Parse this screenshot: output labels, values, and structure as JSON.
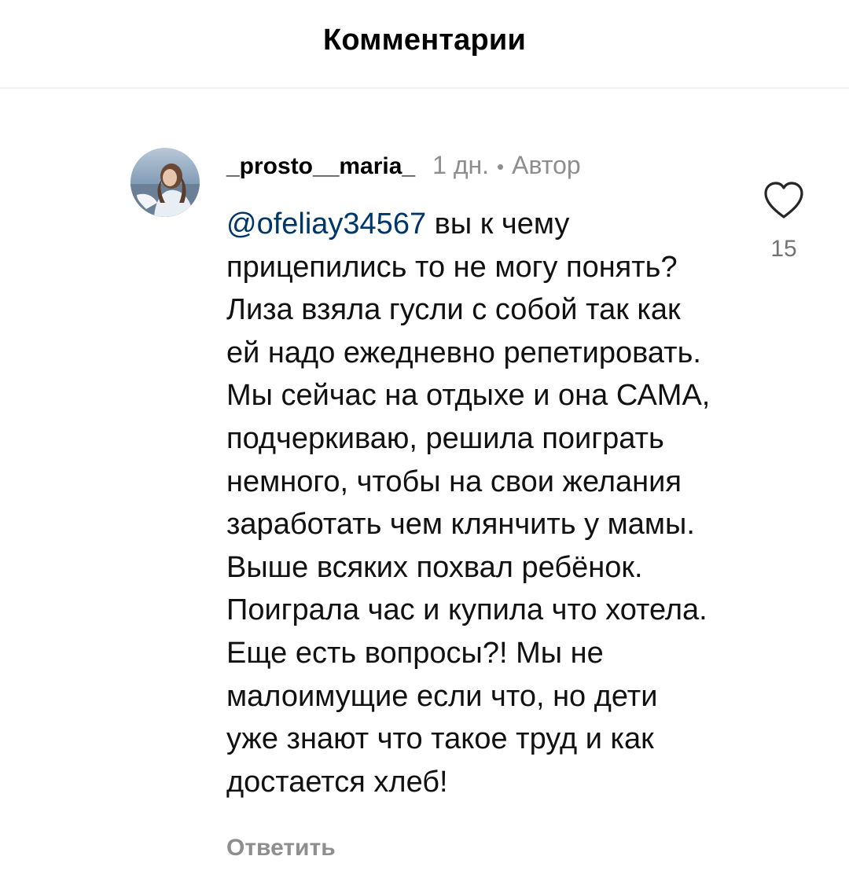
{
  "header": {
    "title": "Комментарии"
  },
  "comment": {
    "username": "_prosto__maria_",
    "time": "1 дн.",
    "separator": "•",
    "badge": "Автор",
    "mention": "@ofeliay34567",
    "text": " вы к чему прицепились то не могу понять? Лиза взяла гусли с собой так как ей надо ежедневно репетировать. Мы сейчас на отдыхе и она САМА, подчеркиваю, решила поиграть немного, чтобы на свои желания заработать чем клянчить у мамы. Выше всяких похвал ребёнок. Поиграла час и купила что хотела. Еще есть вопросы?! Мы не малоимущие если что, но дети уже знают что такое труд и как достается хлеб!",
    "likes": "15",
    "reply_label": "Ответить",
    "avatar_icon": "user-avatar-photo",
    "like_icon": "heart-outline-icon"
  },
  "colors": {
    "mention": "#00376b",
    "secondary": "#8e8e8e",
    "divider": "#efefef"
  }
}
